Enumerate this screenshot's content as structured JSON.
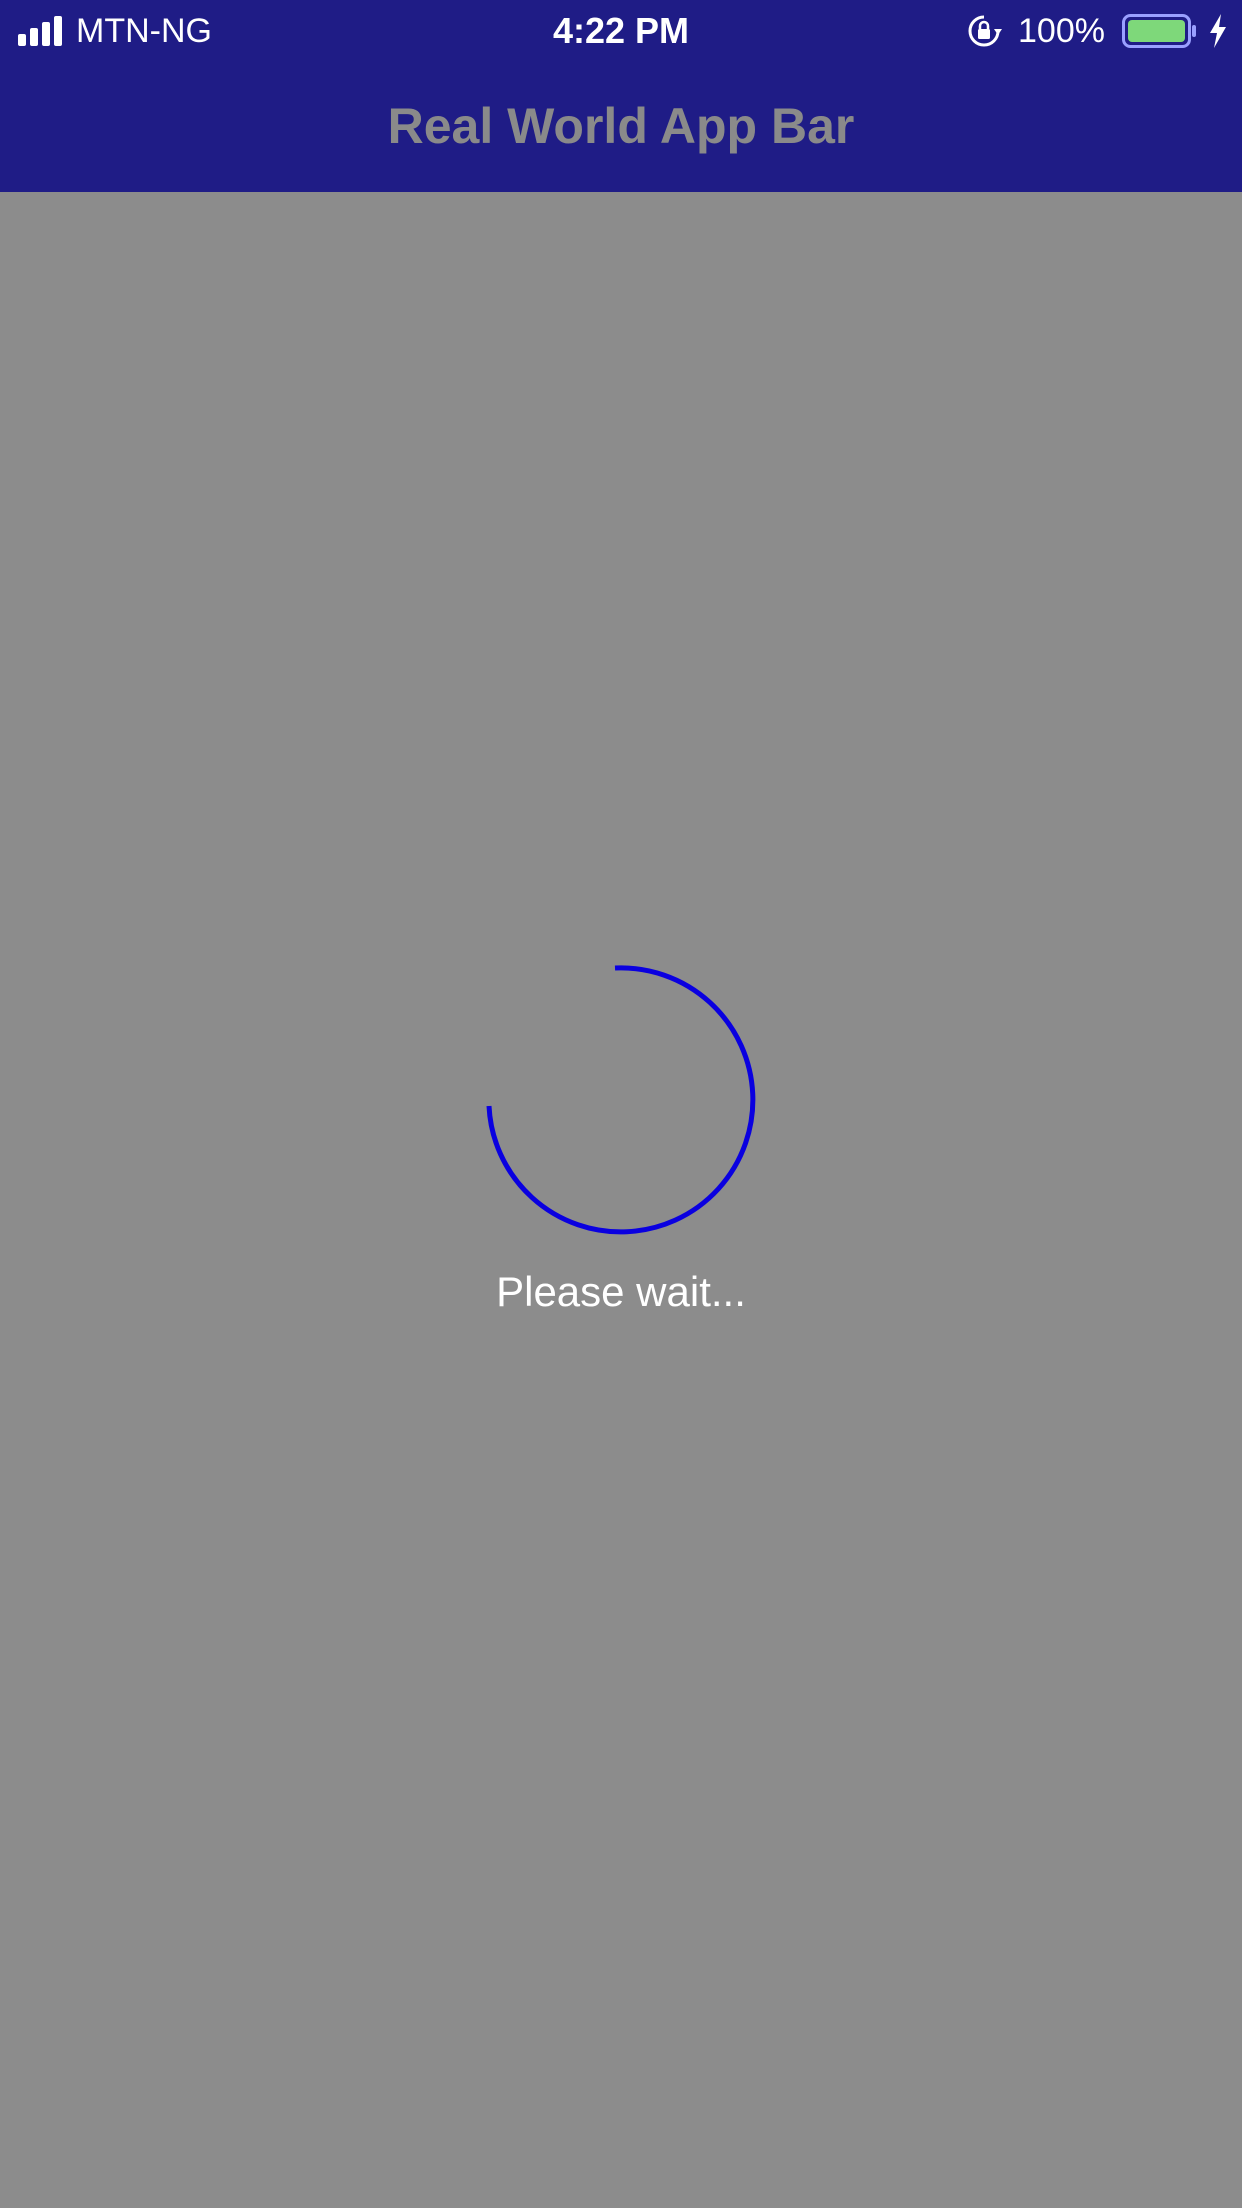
{
  "status_bar": {
    "carrier": "MTN-NG",
    "time": "4:22 PM",
    "battery_percent": "100%",
    "battery_level": 1.0,
    "battery_color": "#7ed87a",
    "icons": [
      "signal-icon",
      "rotation-lock-icon",
      "battery-icon",
      "charging-icon"
    ]
  },
  "app_bar": {
    "title": "Real World App Bar",
    "background": "#1f1c86"
  },
  "loader": {
    "message": "Please wait...",
    "spinner_color": "#0a00e0"
  },
  "colors": {
    "overlay_background": "#8c8c8c"
  }
}
